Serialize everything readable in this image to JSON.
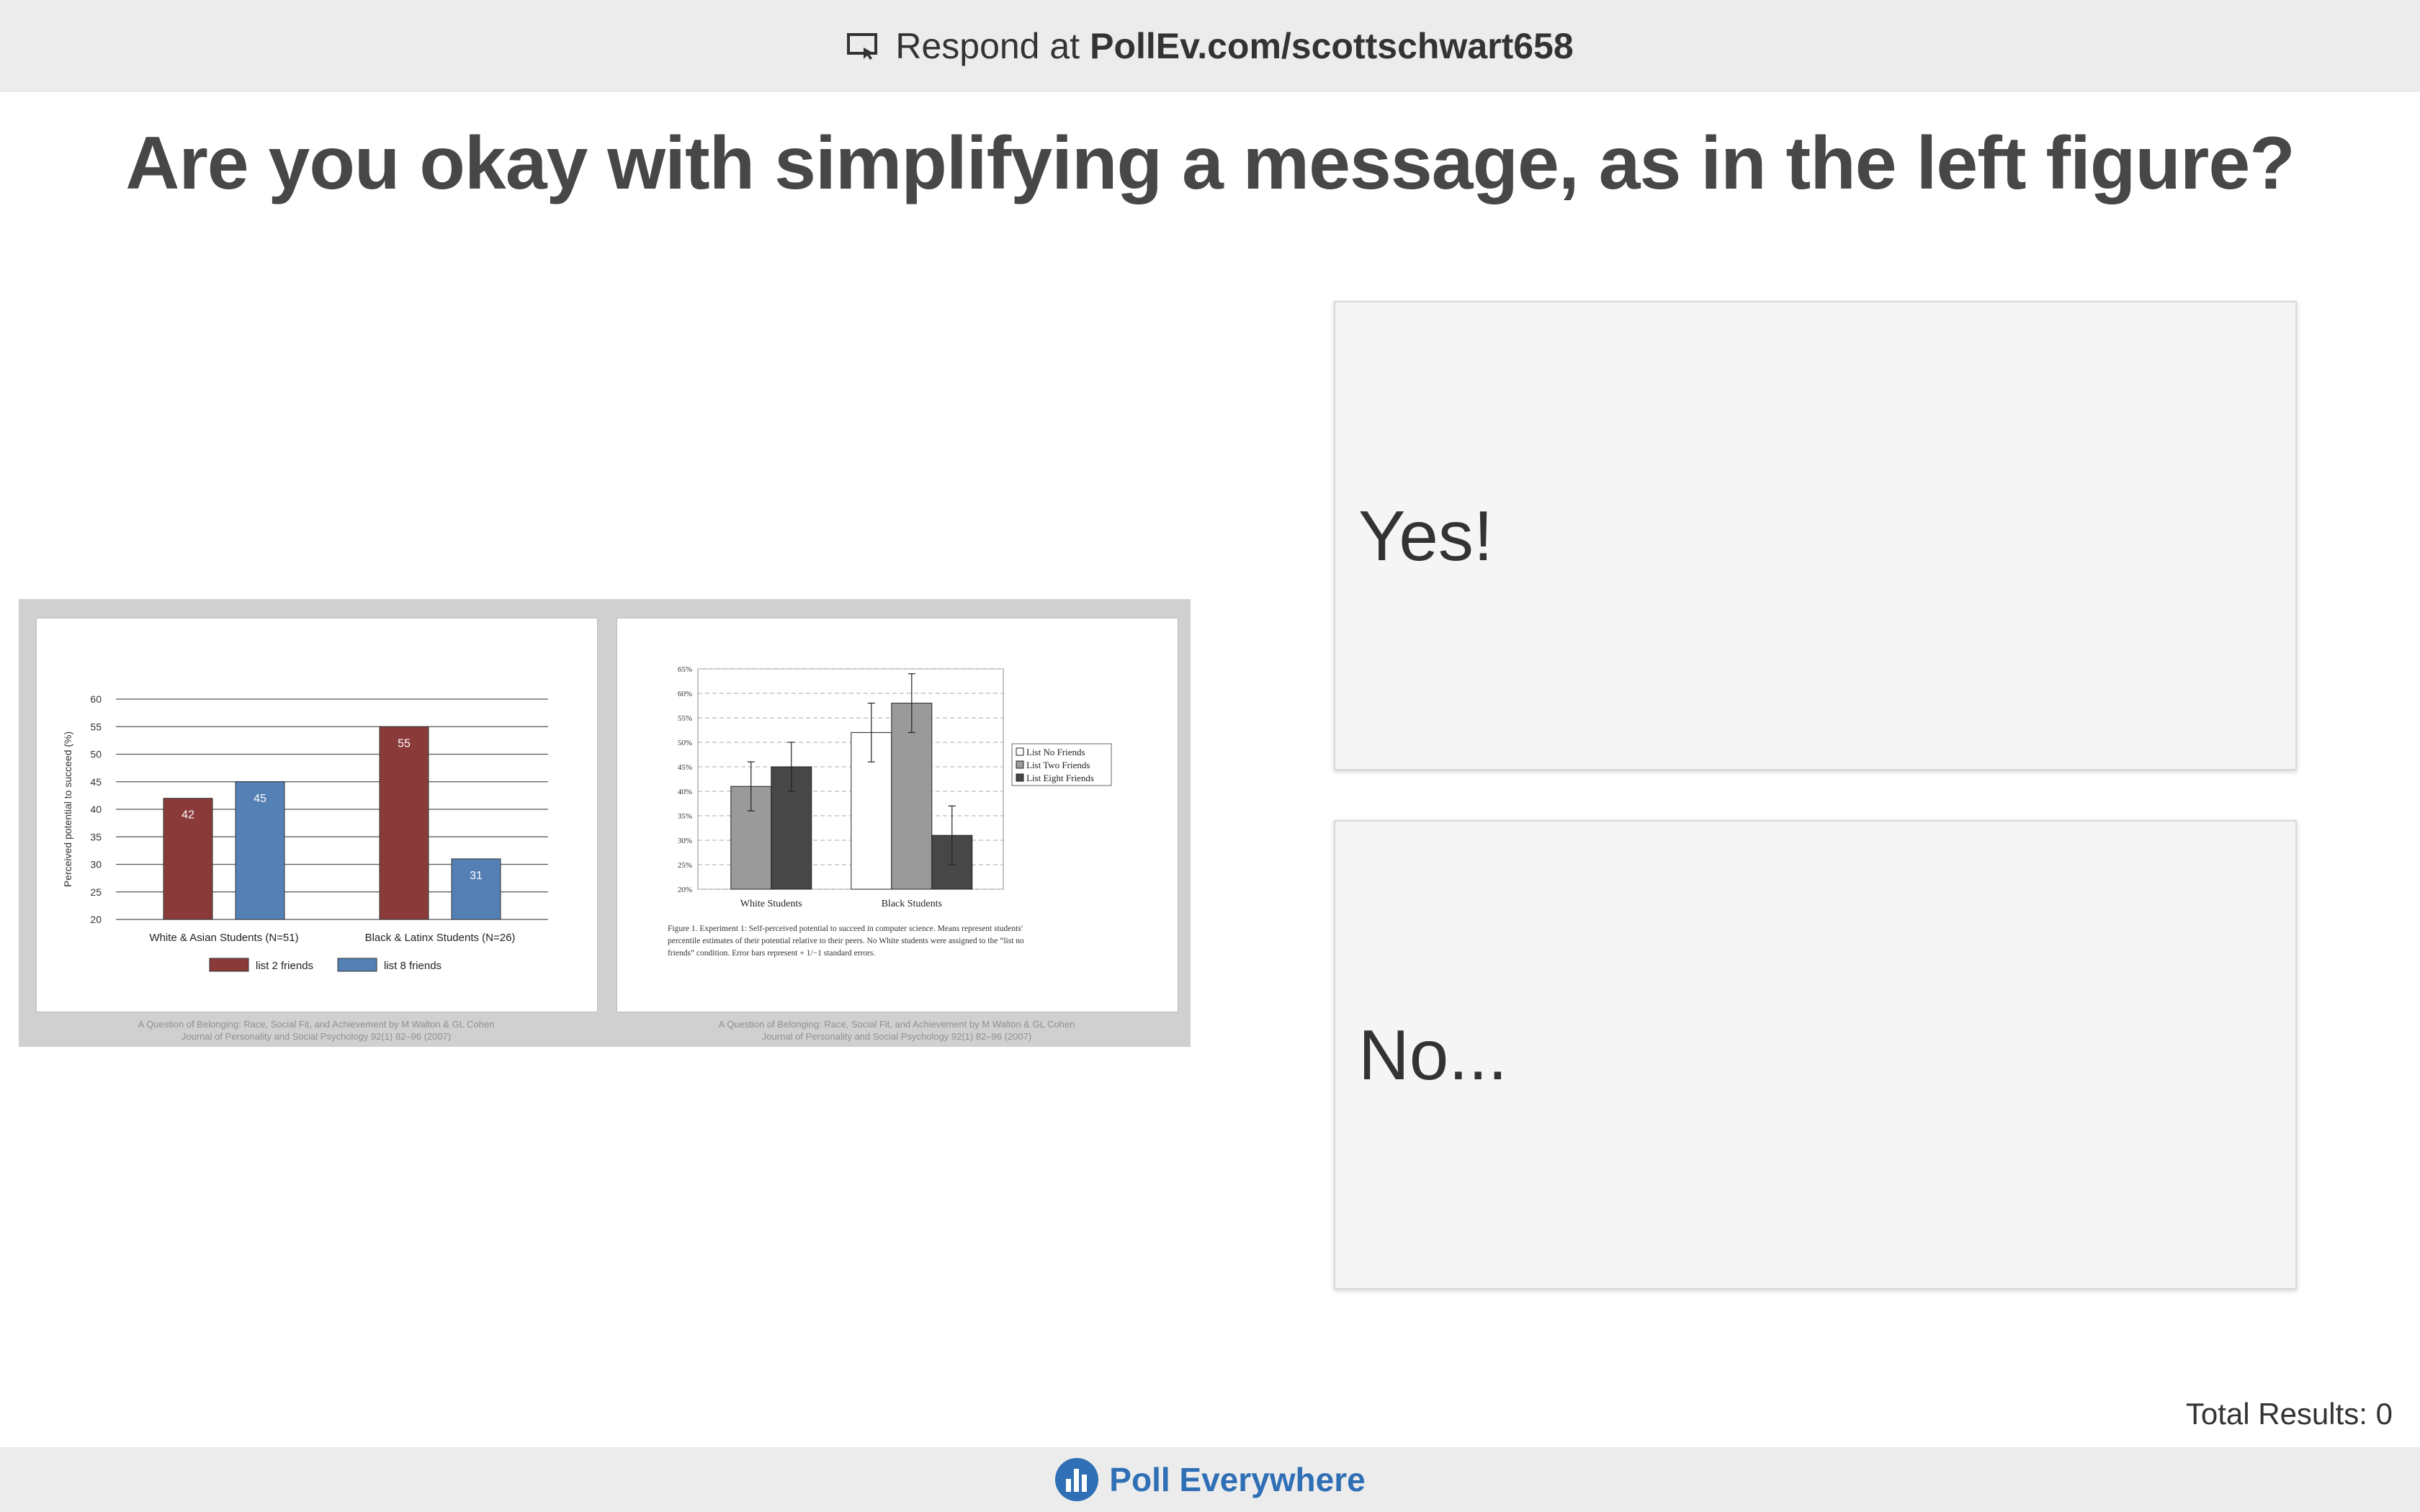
{
  "header": {
    "respond_prefix": "Respond at",
    "respond_url": "PollEv.com/scottschwart658",
    "icon": "present-screen-icon"
  },
  "question": "Are you okay with simplifying a message, as in the left figure?",
  "options": [
    {
      "label": "Yes!"
    },
    {
      "label": "No..."
    }
  ],
  "total_results": "Total Results: 0",
  "footer": {
    "brand": "Poll Everywhere",
    "icon": "poll-everywhere-logo-icon",
    "brand_color": "#2f6fb5"
  },
  "figure": {
    "left_citation": [
      "A Question of Belonging: Race, Social Fit, and Achievement by M Walton & GL Cohen",
      "Journal of Personality and Social Psychology 92(1) 82–96 (2007)"
    ],
    "right_citation": [
      "A Question of Belonging: Race, Social Fit, and Achievement by M Walton & GL Cohen",
      "Journal of Personality and Social Psychology 92(1) 82–96 (2007)"
    ],
    "right_caption": [
      "Figure 1.   Experiment 1: Self-perceived potential to succeed in computer science. Means represent students'",
      "percentile estimates of their potential relative to their peers. No White students were assigned to the “list no",
      "friends” condition. Error bars represent + 1/−1 standard errors."
    ]
  },
  "chart_data": [
    {
      "type": "bar",
      "categories": [
        "White & Asian Students (N=51)",
        "Black & Latinx Students (N=26)"
      ],
      "series": [
        {
          "name": "list 2 friends",
          "values": [
            42,
            55
          ],
          "color": "#8b3a3a"
        },
        {
          "name": "list 8 friends",
          "values": [
            45,
            31
          ],
          "color": "#5580b6"
        }
      ],
      "ylabel": "Perceived potential to succeed (%)",
      "ylim": [
        20,
        60
      ],
      "yticks": [
        "20",
        "25",
        "30",
        "35",
        "40",
        "45",
        "50",
        "55",
        "60"
      ],
      "data_labels": true,
      "legend": "bottom",
      "grid": true
    },
    {
      "type": "bar",
      "categories": [
        "White Students",
        "Black Students"
      ],
      "series": [
        {
          "name": "List No Friends",
          "values": [
            null,
            52
          ],
          "errors": [
            null,
            6
          ],
          "color": "#ffffff"
        },
        {
          "name": "List Two Friends",
          "values": [
            41,
            58
          ],
          "errors": [
            5,
            6
          ],
          "color": "#9a9a9a"
        },
        {
          "name": "List Eight Friends",
          "values": [
            45,
            31
          ],
          "errors": [
            5,
            6
          ],
          "color": "#474747"
        }
      ],
      "ylim": [
        20,
        65
      ],
      "yticks": [
        "20%",
        "25%",
        "30%",
        "35%",
        "40%",
        "45%",
        "50%",
        "55%",
        "60%",
        "65%"
      ],
      "legend": "right",
      "grid": true
    }
  ]
}
